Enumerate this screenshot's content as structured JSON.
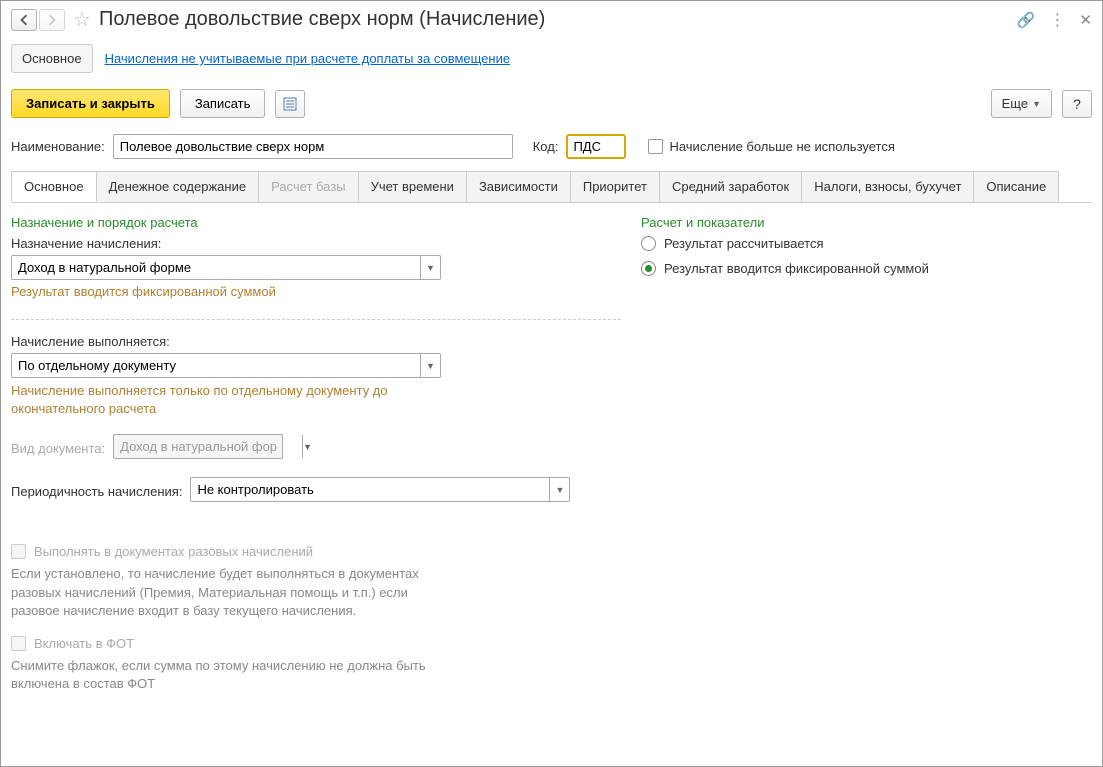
{
  "titlebar": {
    "title": "Полевое довольствие сверх норм (Начисление)"
  },
  "subtabs": {
    "main": "Основное",
    "link": "Начисления не учитываемые при расчете доплаты за совмещение"
  },
  "toolbar": {
    "save_close": "Записать и закрыть",
    "save": "Записать",
    "more": "Еще",
    "help": "?"
  },
  "form": {
    "name_label": "Наименование:",
    "name_value": "Полевое довольствие сверх норм",
    "code_label": "Код:",
    "code_value": "ПДС",
    "not_used_label": "Начисление больше не используется"
  },
  "tabs": {
    "t0": "Основное",
    "t1": "Денежное содержание",
    "t2": "Расчет базы",
    "t3": "Учет времени",
    "t4": "Зависимости",
    "t5": "Приоритет",
    "t6": "Средний заработок",
    "t7": "Налоги, взносы, бухучет",
    "t8": "Описание"
  },
  "left": {
    "section1_title": "Назначение и порядок расчета",
    "purpose_label": "Назначение начисления:",
    "purpose_value": "Доход в натуральной форме",
    "purpose_hint": "Результат вводится фиксированной суммой",
    "executed_label": "Начисление выполняется:",
    "executed_value": "По отдельному документу",
    "executed_hint": "Начисление выполняется только по отдельному документу до окончательного расчета",
    "doctype_label": "Вид документа:",
    "doctype_value": "Доход в натуральной фор",
    "period_label": "Периодичность начисления:",
    "period_value": "Не контролировать",
    "cb1_label": "Выполнять в документах разовых начислений",
    "cb1_hint": "Если установлено, то начисление будет выполняться в документах разовых начислений (Премия, Материальная помощь и т.п.) если разовое начисление входит в базу текущего начисления.",
    "cb2_label": "Включать в ФОТ",
    "cb2_hint": "Снимите флажок, если сумма по этому начислению не должна быть включена в состав ФОТ"
  },
  "right": {
    "section_title": "Расчет и показатели",
    "radio1": "Результат рассчитывается",
    "radio2": "Результат вводится фиксированной суммой"
  }
}
